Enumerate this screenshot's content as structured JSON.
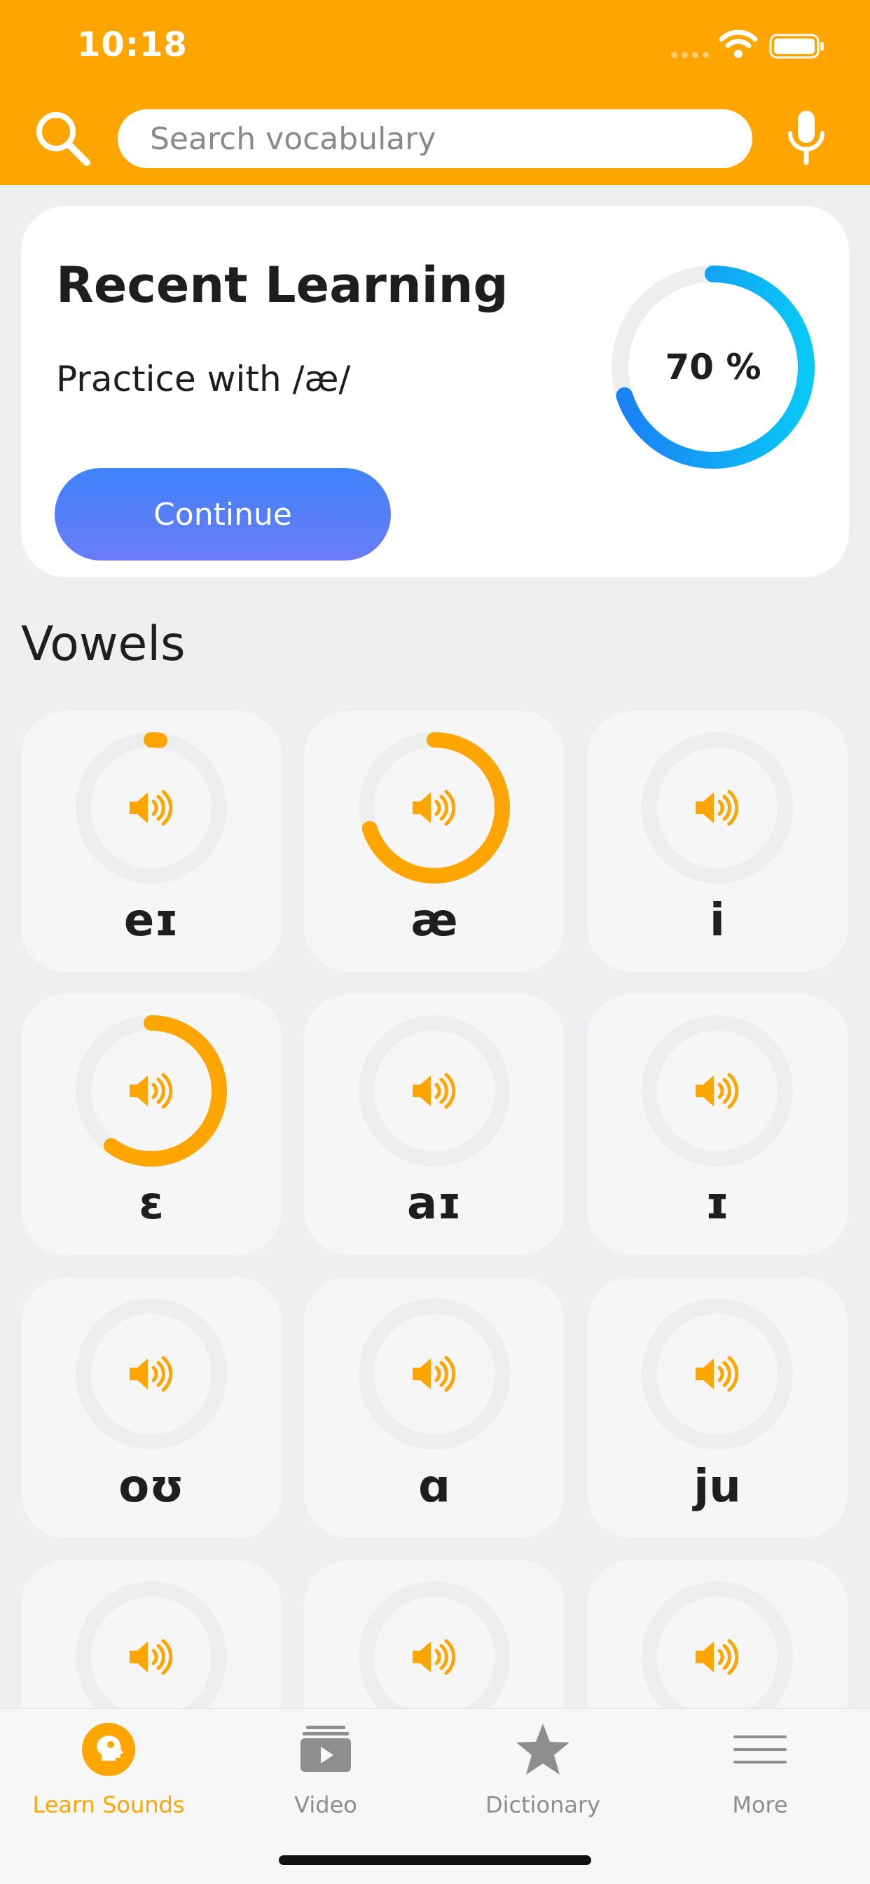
{
  "status_bar": {
    "time": "10:18",
    "icons": [
      "signal-dots",
      "wifi-icon",
      "battery-icon"
    ]
  },
  "header": {
    "background": "#FFA500",
    "search_placeholder": "Search vocabulary",
    "icons": [
      "search-icon",
      "microphone-icon"
    ]
  },
  "recent": {
    "title": "Recent Learning",
    "subtitle": "Practice with /æ/",
    "button_label": "Continue",
    "progress_label": "70 %",
    "progress": 0.7
  },
  "vowels": {
    "title": "Vowels",
    "items": [
      {
        "symbol": "eɪ",
        "progress": 0.02
      },
      {
        "symbol": "æ",
        "progress": 0.7
      },
      {
        "symbol": "i",
        "progress": 0
      },
      {
        "symbol": "ɛ",
        "progress": 0.6
      },
      {
        "symbol": "aɪ",
        "progress": 0
      },
      {
        "symbol": "ɪ",
        "progress": 0
      },
      {
        "symbol": "oʊ",
        "progress": 0
      },
      {
        "symbol": "ɑ",
        "progress": 0
      },
      {
        "symbol": "ju",
        "progress": 0
      },
      {
        "symbol": "",
        "progress": 0
      },
      {
        "symbol": "",
        "progress": 0
      },
      {
        "symbol": "",
        "progress": 0
      }
    ]
  },
  "tabs": [
    {
      "label": "Learn Sounds",
      "icon": "head-icon",
      "active": true
    },
    {
      "label": "Video",
      "icon": "video-icon",
      "active": false
    },
    {
      "label": "Dictionary",
      "icon": "star-icon",
      "active": false
    },
    {
      "label": "More",
      "icon": "menu-icon",
      "active": false
    }
  ],
  "colors": {
    "accent": "#FFA500",
    "progress_blue": "#1E8FF7",
    "ring_track": "#EEEEEE"
  }
}
